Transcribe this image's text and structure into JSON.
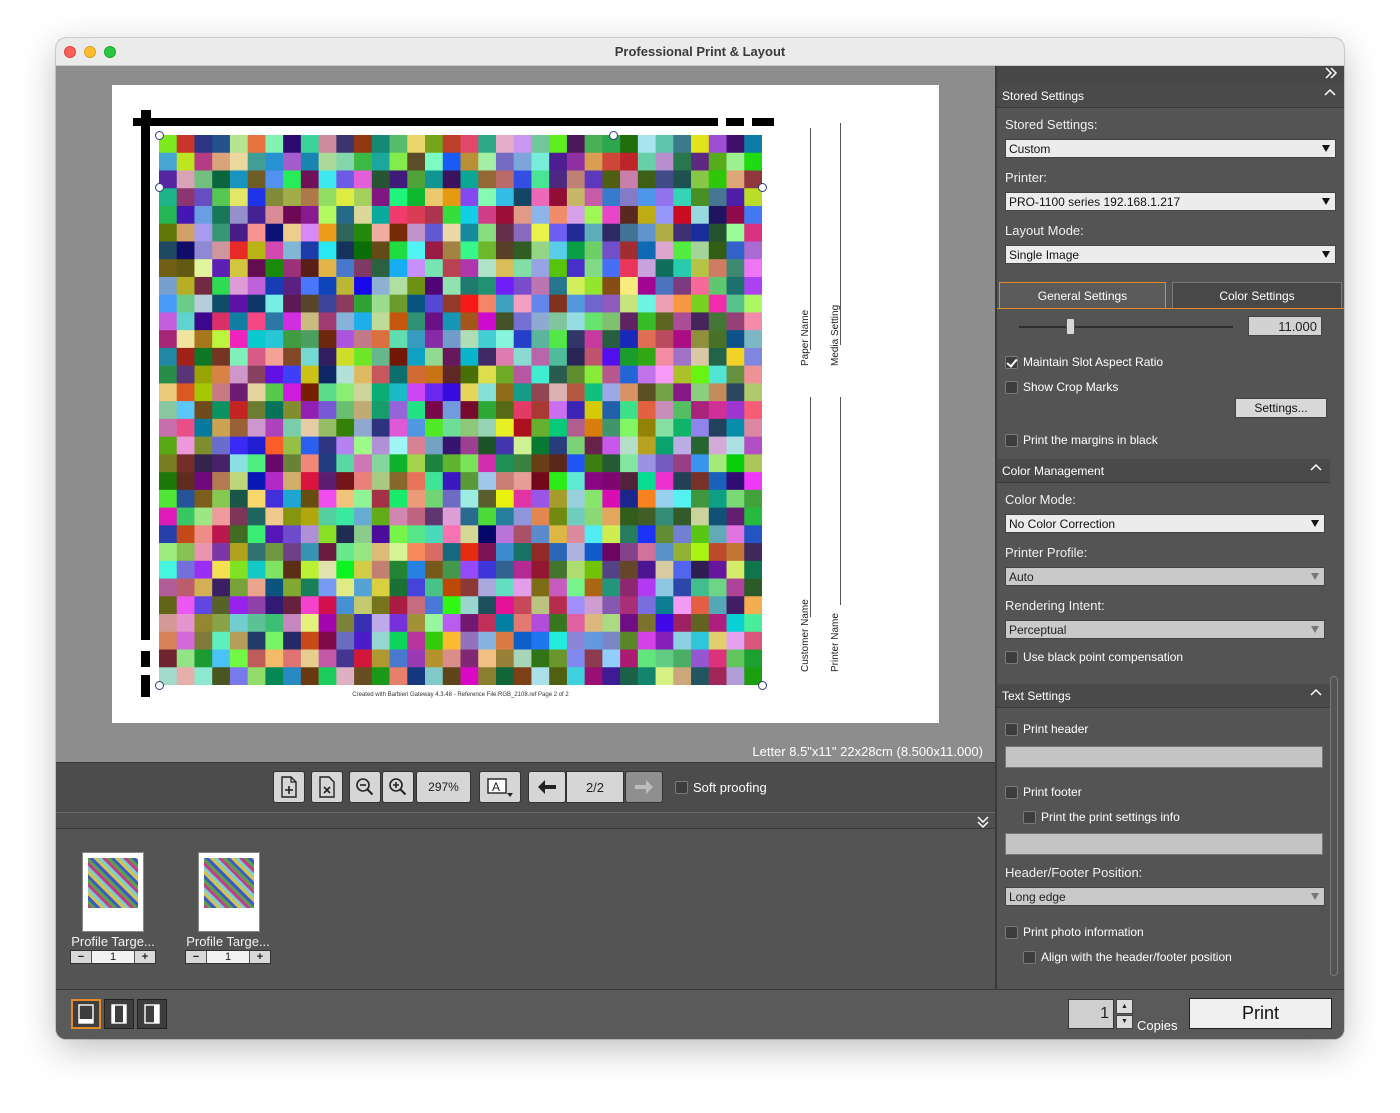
{
  "window": {
    "title": "Professional Print & Layout"
  },
  "preview": {
    "paper_size": "Letter 8.5\"x11\" 22x28cm (8.500x11.000)",
    "footer_note": "Created with Barbieri Gateway 4.3.48 - Reference File:RGB_2108.ref Page 2 of 2",
    "side_labels": {
      "paper_name": "Paper Name",
      "media_setting": "Media Setting",
      "customer_name": "Customer Name",
      "printer_name": "Printer Name"
    }
  },
  "toolbar": {
    "zoom": "297%",
    "page_indicator": "2/2",
    "soft_proofing_label": "Soft proofing",
    "soft_proofing_checked": false
  },
  "thumbnails": [
    {
      "label": "Profile Targe...",
      "count": "1"
    },
    {
      "label": "Profile Targe...",
      "count": "1"
    }
  ],
  "bottom": {
    "copies_value": "1",
    "copies_label": "Copies",
    "print_label": "Print"
  },
  "sidebar": {
    "stored_settings": {
      "section_title": "Stored Settings",
      "stored_label": "Stored Settings:",
      "stored_value": "Custom",
      "printer_label": "Printer:",
      "printer_value": "PRO-1100 series 192.168.1.217",
      "layout_label": "Layout Mode:",
      "layout_value": "Single Image"
    },
    "tabs": {
      "general": "General Settings",
      "color": "Color Settings"
    },
    "general": {
      "slider_value": "11.000",
      "maintain_aspect": "Maintain Slot Aspect Ratio",
      "show_crop_marks": "Show Crop Marks",
      "settings_button": "Settings...",
      "print_margins_black": "Print the margins in black"
    },
    "color_management": {
      "section_title": "Color Management",
      "color_mode_label": "Color Mode:",
      "color_mode_value": "No Color Correction",
      "printer_profile_label": "Printer Profile:",
      "printer_profile_value": "Auto",
      "rendering_intent_label": "Rendering Intent:",
      "rendering_intent_value": "Perceptual",
      "black_point": "Use black point compensation"
    },
    "text_settings": {
      "section_title": "Text Settings",
      "print_header": "Print header",
      "print_footer": "Print footer",
      "print_settings_info": "Print the print settings info",
      "position_label": "Header/Footer Position:",
      "position_value": "Long edge",
      "print_photo_info": "Print photo information",
      "align_header_footer": "Align with the header/footer position"
    }
  },
  "colors": {
    "accent": "#e08a2a",
    "window_bg": "#5b5b5b",
    "preview_bg": "#8d8d8d"
  }
}
